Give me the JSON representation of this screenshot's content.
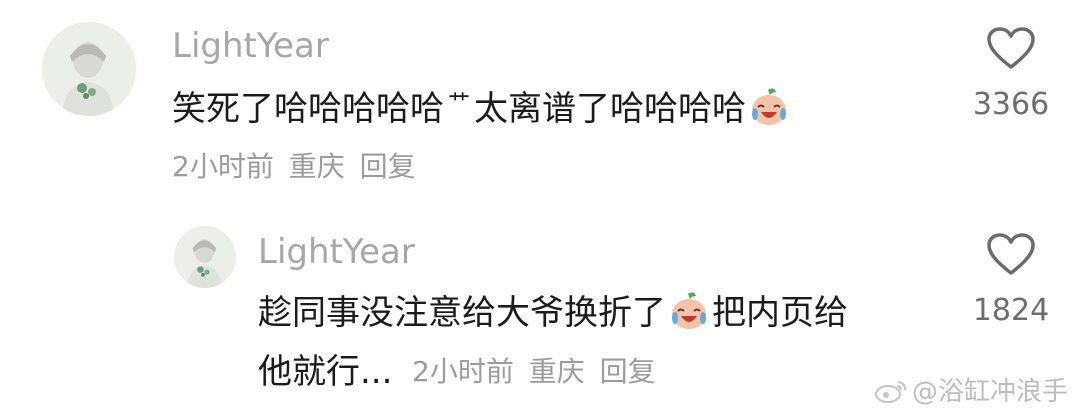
{
  "comments": [
    {
      "username": "LightYear",
      "text_parts": [
        "笑死了哈哈哈哈哈",
        "艹",
        "太离谱了哈哈哈哈"
      ],
      "emoji": "laughing-crying-emoji",
      "time": "2小时前",
      "location": "重庆",
      "reply_label": "回复",
      "like_icon": "heart-outline-icon",
      "like_count": "3366"
    },
    {
      "username": "LightYear",
      "text_line1_before_emoji": "趁同事没注意给大爷换折了",
      "emoji": "laughing-crying-emoji",
      "text_line1_after_emoji": "把内页给",
      "text_line2": "他就行...",
      "time": "2小时前",
      "location": "重庆",
      "reply_label": "回复",
      "like_icon": "heart-outline-icon",
      "like_count": "1824"
    }
  ],
  "watermark": {
    "icon": "weibo-icon",
    "text": "@浴缸冲浪手"
  }
}
